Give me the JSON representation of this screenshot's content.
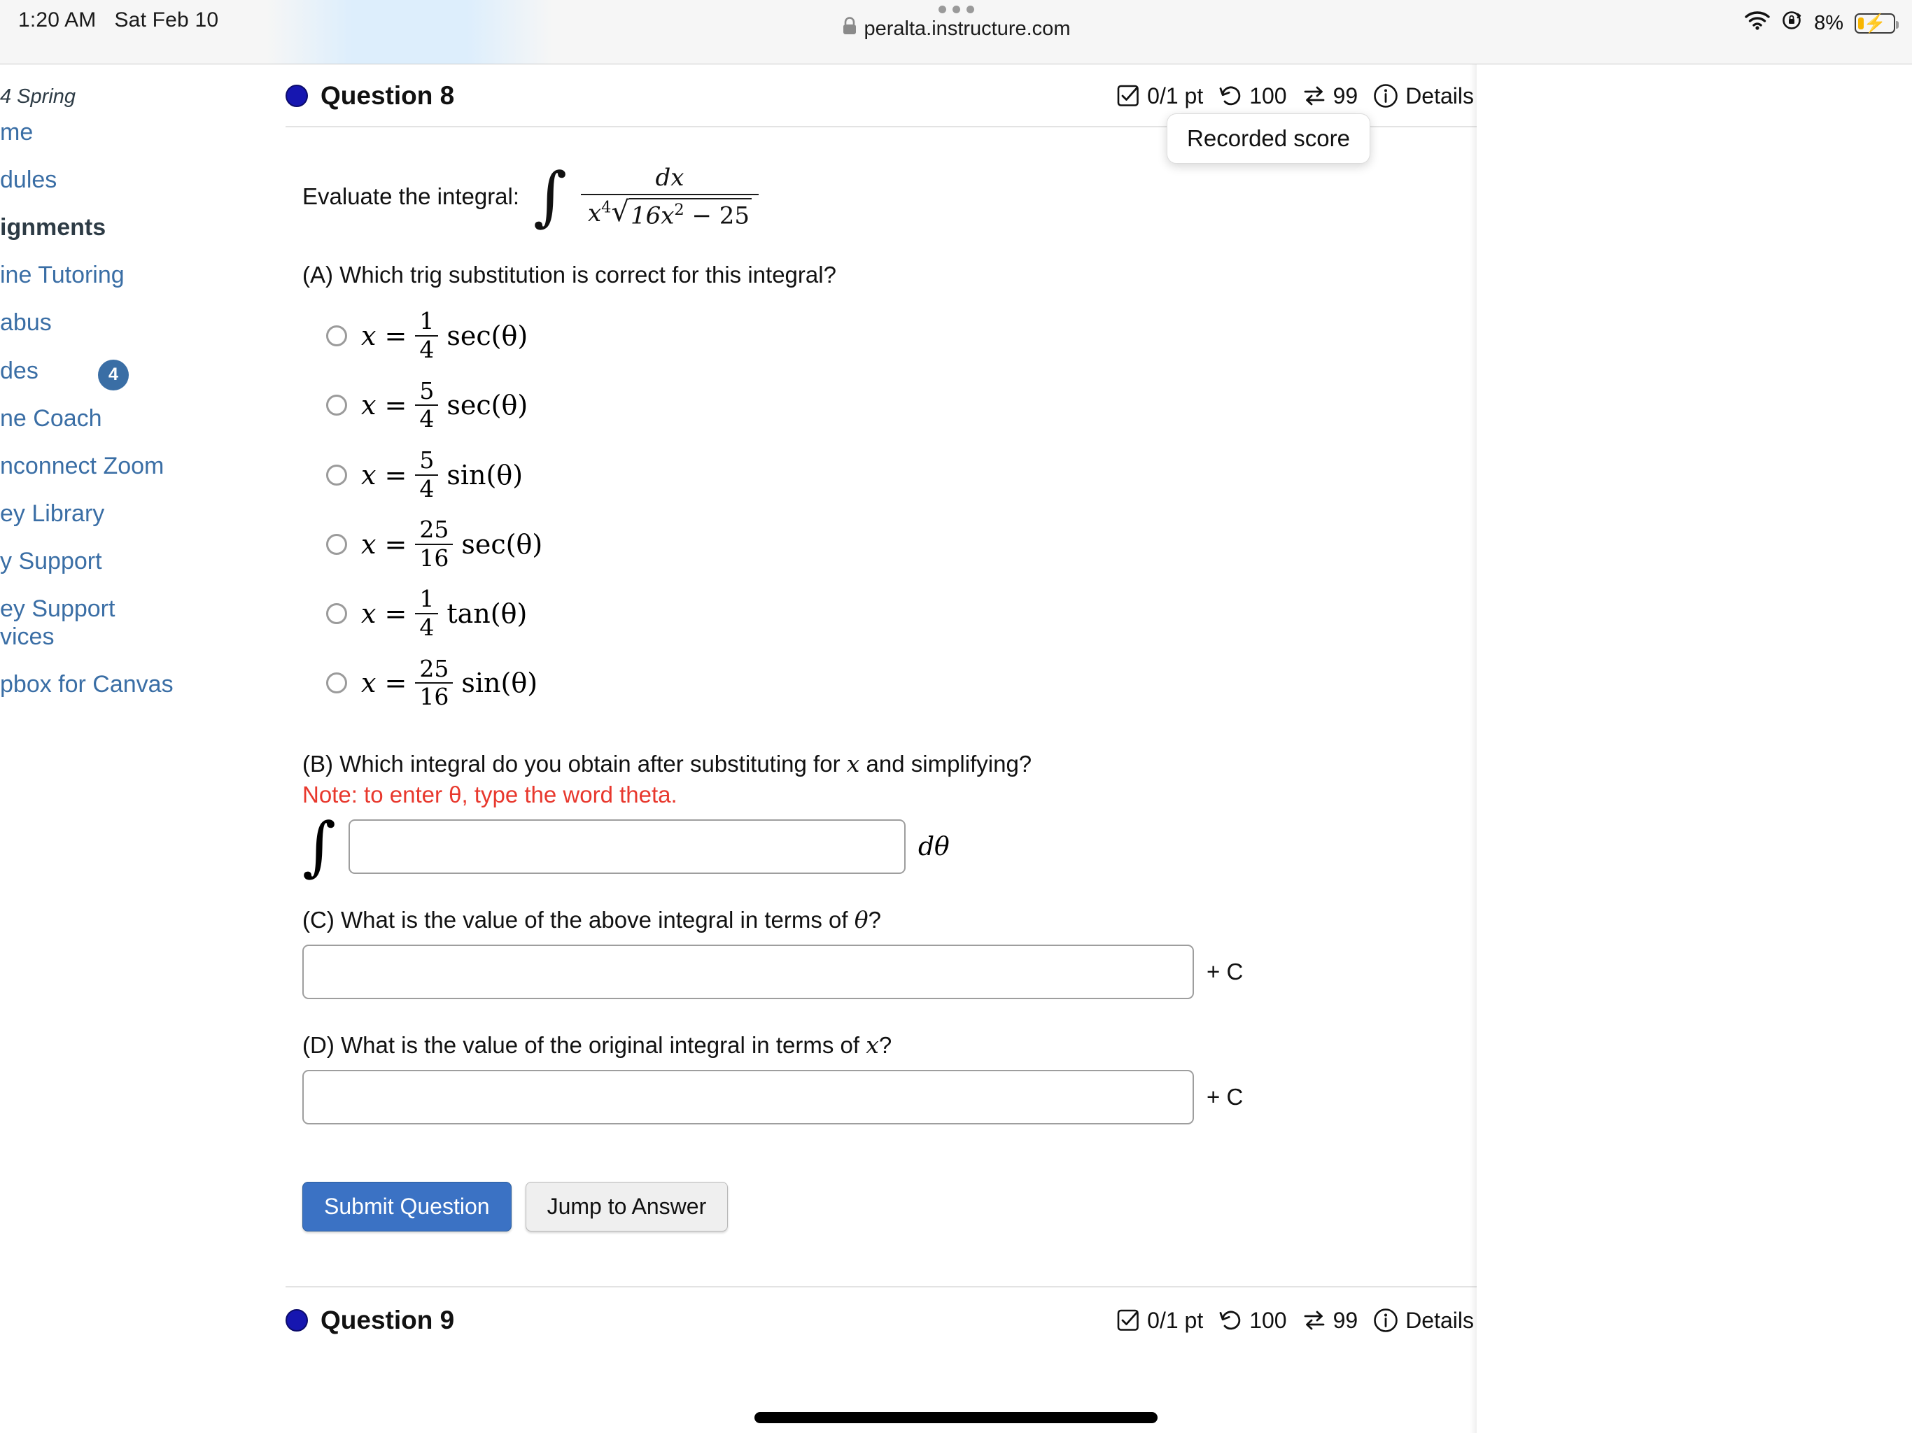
{
  "status_bar": {
    "time": "1:20 AM",
    "date": "Sat Feb 10",
    "battery_percent": "8%",
    "wifi_icon": "wifi-icon",
    "rotation_lock_icon": "rotation-lock-icon",
    "battery_icon": "battery-charging-icon"
  },
  "browser": {
    "url": "peralta.instructure.com",
    "lock_icon": "lock-icon",
    "tab_overview_icon": "tab-overview-dots-icon"
  },
  "sidebar": {
    "term": "4 Spring",
    "items": [
      {
        "label": "me",
        "active": false,
        "badge": ""
      },
      {
        "label": "dules",
        "active": false,
        "badge": ""
      },
      {
        "label": "ignments",
        "active": true,
        "badge": ""
      },
      {
        "label": "ine Tutoring",
        "active": false,
        "badge": ""
      },
      {
        "label": "abus",
        "active": false,
        "badge": ""
      },
      {
        "label": "des",
        "active": false,
        "badge": "4"
      },
      {
        "label": "ne Coach",
        "active": false,
        "badge": ""
      },
      {
        "label": "nconnect Zoom",
        "active": false,
        "badge": ""
      },
      {
        "label": "ey Library",
        "active": false,
        "badge": ""
      },
      {
        "label": "y Support",
        "active": false,
        "badge": ""
      },
      {
        "label": "ey Support vices",
        "active": false,
        "badge": ""
      },
      {
        "label": "pbox for Canvas",
        "active": false,
        "badge": ""
      }
    ]
  },
  "question": {
    "title": "Question 8",
    "points": "0/1 pt",
    "attempts": "100",
    "retries": "99",
    "details_label": "Details",
    "tooltip": "Recorded score",
    "icons": {
      "points": "checkbox-check-icon",
      "attempts": "undo-rotate-icon",
      "retries": "swap-arrows-icon",
      "details": "info-circle-icon"
    },
    "prompt_prefix": "Evaluate the integral:",
    "integral": {
      "numerator": "dx",
      "denominator": "x⁴√(16x² − 25)",
      "denom_base": "x",
      "denom_exp": "4",
      "radicand_a": "16x",
      "radicand_exp": "2",
      "radicand_b": "− 25"
    },
    "part_a": {
      "label": "(A) Which trig substitution is correct for this integral?",
      "options": [
        {
          "lhs": "x =",
          "num": "1",
          "den": "4",
          "func": "sec(θ)"
        },
        {
          "lhs": "x =",
          "num": "5",
          "den": "4",
          "func": "sec(θ)"
        },
        {
          "lhs": "x =",
          "num": "5",
          "den": "4",
          "func": "sin(θ)"
        },
        {
          "lhs": "x =",
          "num": "25",
          "den": "16",
          "func": "sec(θ)"
        },
        {
          "lhs": "x =",
          "num": "1",
          "den": "4",
          "func": "tan(θ)"
        },
        {
          "lhs": "x =",
          "num": "25",
          "den": "16",
          "func": "sin(θ)"
        }
      ]
    },
    "part_b": {
      "label_pre": "(B) Which integral do you obtain after substituting for ",
      "label_var": "x",
      "label_post": " and simplifying?",
      "note": "Note: to enter θ, type the word theta.",
      "input_value": "",
      "input_placeholder": "",
      "suffix": "dθ"
    },
    "part_c": {
      "label_pre": "(C) What is the value of the above integral in terms of ",
      "label_var": "θ",
      "label_post": "?",
      "input_value": "",
      "input_placeholder": "",
      "suffix": "+ C"
    },
    "part_d": {
      "label_pre": "(D) What is the value of the original integral in terms of ",
      "label_var": "x",
      "label_post": "?",
      "input_value": "",
      "input_placeholder": "",
      "suffix": "+ C"
    },
    "submit_label": "Submit Question",
    "jump_label": "Jump to Answer"
  },
  "next_question": {
    "title": "Question 9",
    "points": "0/1 pt",
    "attempts": "100",
    "retries": "99",
    "details_label": "Details"
  },
  "colors": {
    "link_blue": "#3a6ea5",
    "badge_blue": "#3a6ea5",
    "submit_blue": "#3b72c4",
    "note_red": "#e8382d",
    "bullet_navy": "#1616b0",
    "battery_yellow": "#f7b500"
  }
}
